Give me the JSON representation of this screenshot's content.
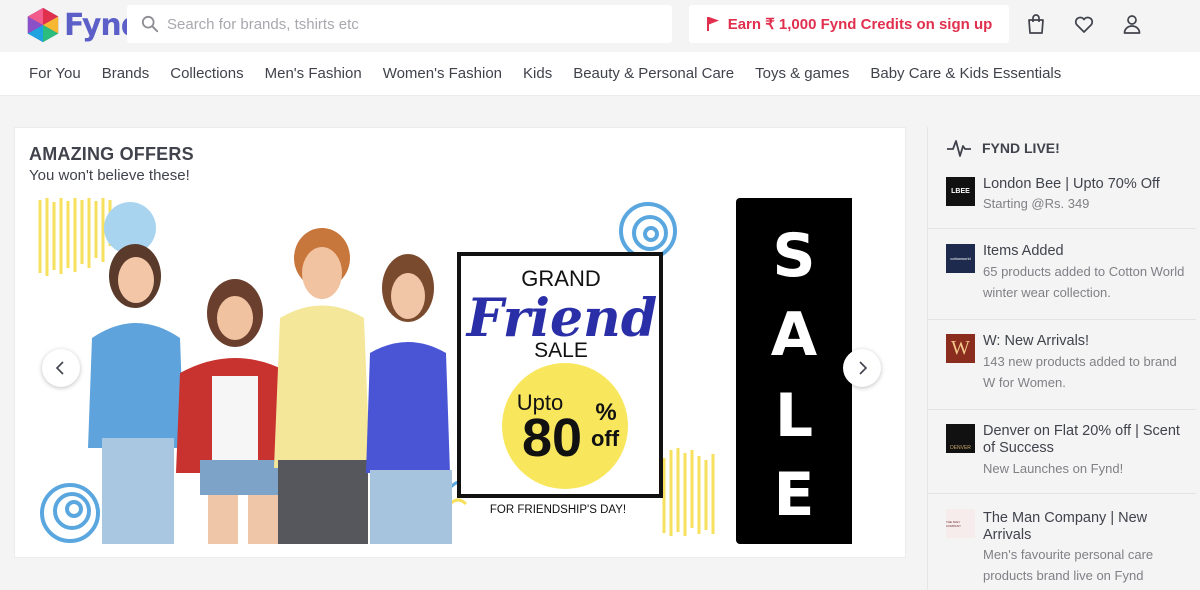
{
  "brand": {
    "name": "Fynd"
  },
  "search": {
    "placeholder": "Search for brands, tshirts etc"
  },
  "promo": {
    "earn_label": "Earn ₹ 1,000 Fynd Credits on sign up"
  },
  "nav": {
    "items": [
      "For You",
      "Brands",
      "Collections",
      "Men's Fashion",
      "Women's Fashion",
      "Kids",
      "Beauty & Personal Care",
      "Toys & games",
      "Baby Care & Kids Essentials"
    ]
  },
  "offers": {
    "title": "AMAZING OFFERS",
    "subtitle": "You won't believe these!",
    "banner": {
      "line1": "GRAND",
      "line2": "Friend",
      "line3": "SALE",
      "upto": "Upto",
      "percent": "80",
      "pct_sign": "%",
      "off": "off",
      "footer": "FOR FRIENDSHIP'S DAY!"
    },
    "banner2": {
      "letters": [
        "S",
        "A",
        "L",
        "E"
      ]
    }
  },
  "live": {
    "title": "FYND LIVE!",
    "items": [
      {
        "logo_text": "LBEE",
        "title": "London Bee | Upto 70% Off",
        "desc": "Starting @Rs. 349"
      },
      {
        "logo_text": "cottonworld",
        "title": "Items Added",
        "desc": "65 products added to Cotton World winter wear collection."
      },
      {
        "logo_text": "W",
        "title": "W: New Arrivals!",
        "desc": "143 new products added to brand W for Women."
      },
      {
        "logo_text": "DENVER",
        "title": "Denver on Flat 20% off | Scent of Success",
        "desc": "New Launches on Fynd!"
      },
      {
        "logo_text": "THE MAN COMPANY",
        "title": "The Man Company | New Arrivals",
        "desc": "Men's favourite personal care products brand live on Fynd"
      }
    ]
  },
  "colors": {
    "brand": "#5b5fc7",
    "promo": "#e0304e",
    "text": "#41434c",
    "muted": "#808086"
  },
  "icons": {
    "search": "search-icon",
    "flag": "flag-icon",
    "bag": "bag-icon",
    "wishlist": "heart-icon",
    "profile": "user-icon",
    "live": "pulse-icon"
  }
}
